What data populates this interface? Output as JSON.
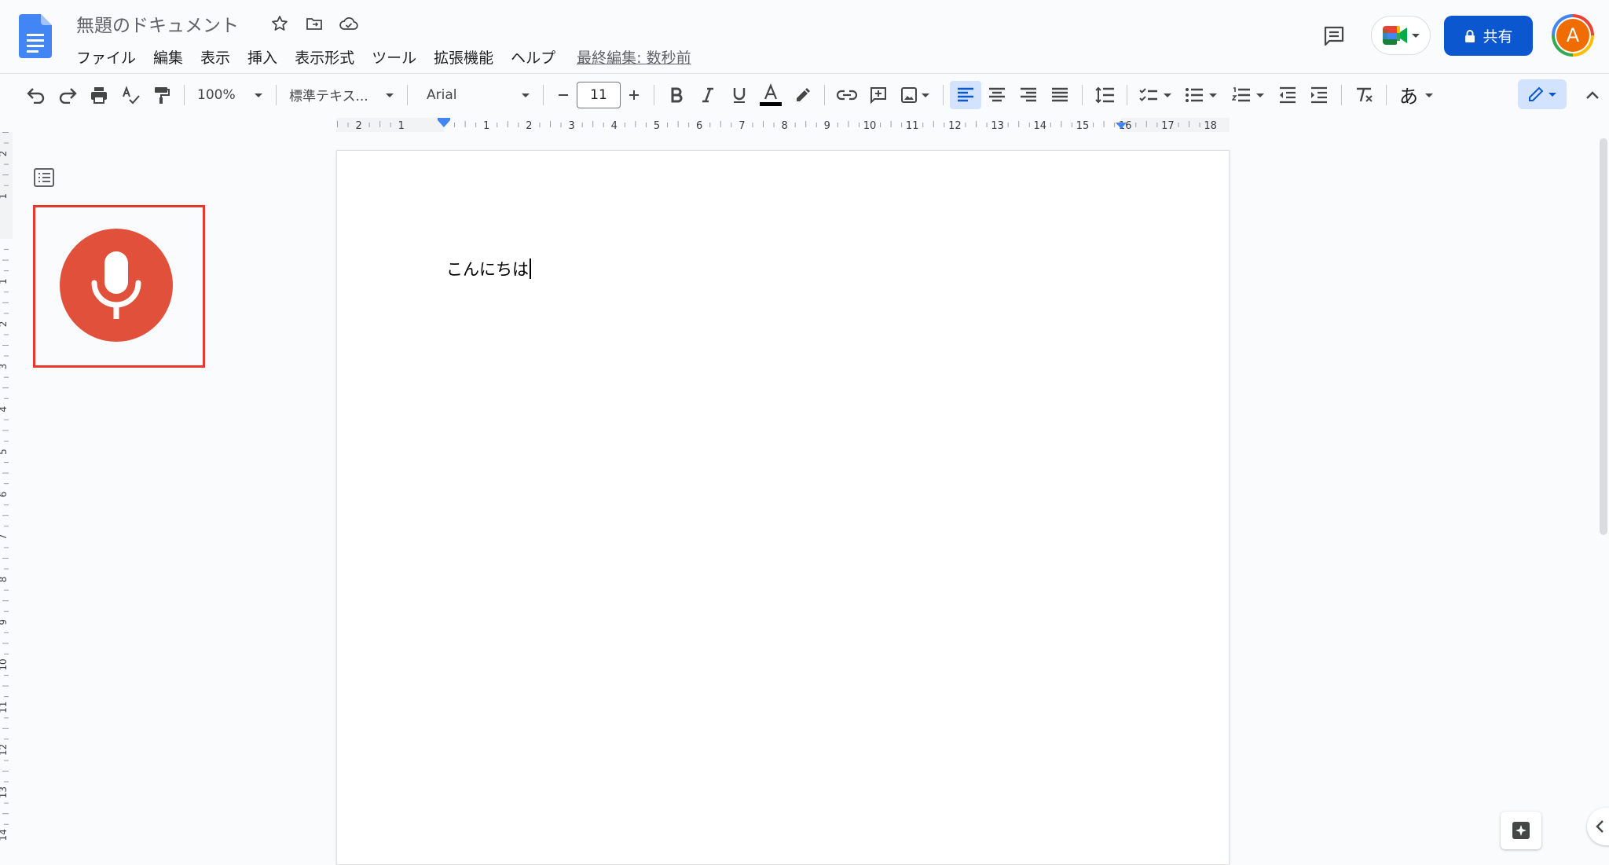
{
  "document": {
    "title": "無題のドキュメント",
    "last_edit": "最終編集: 数秒前",
    "body_text": "こんにちは"
  },
  "menu": {
    "items": [
      "ファイル",
      "編集",
      "表示",
      "挿入",
      "表示形式",
      "ツール",
      "拡張機能",
      "ヘルプ"
    ]
  },
  "header": {
    "share_label": "共有",
    "avatar_initial": "A"
  },
  "toolbar": {
    "zoom": "100%",
    "style": "標準テキス...",
    "font": "Arial",
    "font_size": "11",
    "input_tool": "あ"
  },
  "ruler": {
    "h_labels": [
      "2",
      "1",
      "1",
      "2",
      "3",
      "4",
      "5",
      "6",
      "7",
      "8",
      "9",
      "10",
      "11",
      "12",
      "13",
      "14",
      "15",
      "16",
      "17",
      "18"
    ],
    "v_labels": [
      "2",
      "1",
      "1",
      "2",
      "3",
      "4",
      "5",
      "6",
      "7",
      "8",
      "9",
      "10",
      "11",
      "12",
      "13",
      "14"
    ]
  },
  "icons": {
    "docs": "docs-logo-icon",
    "star": "star-icon",
    "move": "move-to-folder-icon",
    "cloud": "cloud-status-icon",
    "comment": "comment-history-icon",
    "meet": "meet-icon",
    "lock": "lock-icon",
    "mic": "microphone-icon"
  },
  "colors": {
    "accent": "#0b57d0",
    "mic": "#e0503a",
    "highlight_frame": "#e53a2a",
    "avatar": "#ef6c00",
    "active_tool": "#d3e3fd"
  }
}
